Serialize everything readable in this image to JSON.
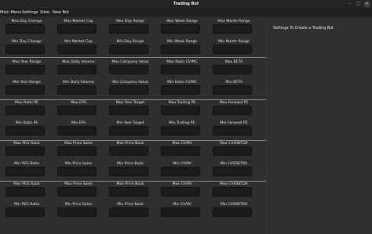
{
  "window": {
    "title": "Trading Bot",
    "controls": [
      "–",
      "□",
      "✕"
    ]
  },
  "menu": [
    "Main Menu",
    "Settings",
    "View",
    "New Bot"
  ],
  "panel": {
    "title": "Settings To Create a Trading Bot"
  },
  "grid_rows": [
    [
      "Max Day Change",
      "Max Market Cap",
      "Max Day Range",
      "Max Week Range",
      "Max Month Range"
    ],
    [
      "Min Day Change",
      "Min Market Cap",
      "Min Day Range",
      "Min Week Range",
      "Min Month Range"
    ],
    [
      "Max Year Range",
      "Max Daily Volume",
      "Max Company Value",
      "Max Ratio CV/MC",
      "Max BETA"
    ],
    [
      "Min Year Range",
      "Min Daily Volume",
      "Min Company Value",
      "Min Ratio CV/MC",
      "Min BETA"
    ],
    [
      "Max Ratio PE",
      "Max EPS",
      "Max Year Target",
      "Max Trailing PE",
      "Max Forward PE"
    ],
    [
      "Min Ratio PE",
      "Min EPS",
      "Min Year Target",
      "Min Trailing PE",
      "Min Forward PE"
    ],
    [
      "Max PEG Ratio",
      "Max Price Sales",
      "Max Price Book",
      "Max CV/RV",
      "Max CV/EBITDA"
    ],
    [
      "Min PEG Ratio",
      "Min Price Sales",
      "Min Price Book",
      "Min CV/RV",
      "Min CV/EBITDA"
    ],
    [
      "Max PEG Ratio",
      "Max Price Sales",
      "Max Price Book",
      "Max CV/RV",
      "Max CV/EBITDA"
    ],
    [
      "Min PEG Ratio",
      "Min Price Sales",
      "Min Price Book",
      "Min CV/RV",
      "Min CV/EBITDA"
    ]
  ]
}
